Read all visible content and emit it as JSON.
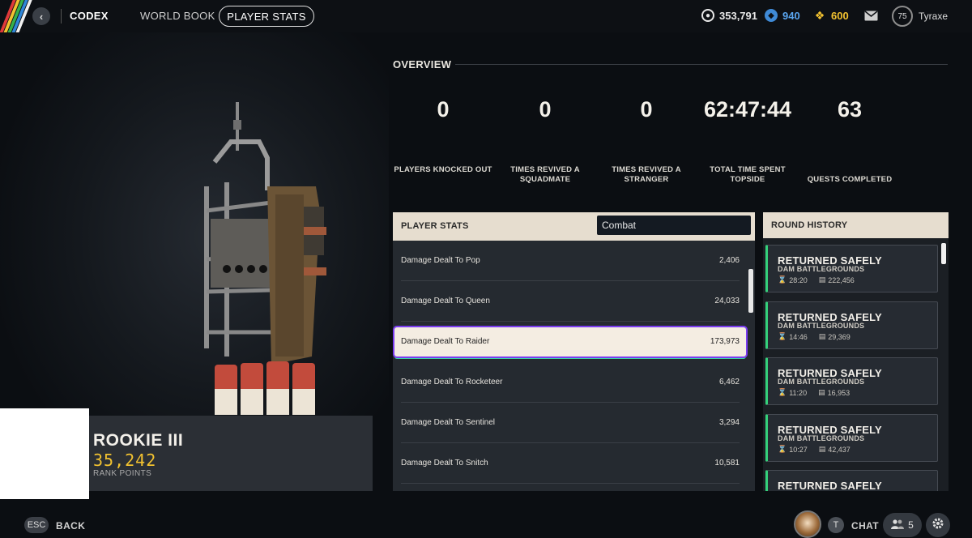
{
  "nav": {
    "codex": "CODEX",
    "world_book": "WORLD BOOK",
    "player_stats": "PLAYER STATS"
  },
  "currency": {
    "coins": "353,791",
    "blue": "940",
    "gold": "600"
  },
  "user": {
    "level": "75",
    "name": "Tyraxe"
  },
  "rank": {
    "name": "ROOKIE III",
    "points": "35,242",
    "label": "RANK POINTS"
  },
  "overview": {
    "title": "OVERVIEW",
    "stats": [
      {
        "value": "0",
        "label": "PLAYERS KNOCKED OUT"
      },
      {
        "value": "0",
        "label": "TIMES REVIVED A SQUADMATE"
      },
      {
        "value": "0",
        "label": "TIMES REVIVED A STRANGER"
      },
      {
        "value": "62:47:44",
        "label": "TOTAL TIME SPENT TOPSIDE"
      },
      {
        "value": "63",
        "label": "QUESTS COMPLETED"
      }
    ]
  },
  "player_stats": {
    "title": "PLAYER STATS",
    "category": "Combat",
    "rows": [
      {
        "name": "Damage Dealt To Pop",
        "value": "2,406"
      },
      {
        "name": "Damage Dealt To Queen",
        "value": "24,033"
      },
      {
        "name": "Damage Dealt To Raider",
        "value": "173,973"
      },
      {
        "name": "Damage Dealt To Rocketeer",
        "value": "6,462"
      },
      {
        "name": "Damage Dealt To Sentinel",
        "value": "3,294"
      },
      {
        "name": "Damage Dealt To Snitch",
        "value": "10,581"
      }
    ]
  },
  "round_history": {
    "title": "ROUND HISTORY",
    "rounds": [
      {
        "result": "RETURNED SAFELY",
        "map": "DAM BATTLEGROUNDS",
        "time": "28:20",
        "loot": "222,456"
      },
      {
        "result": "RETURNED SAFELY",
        "map": "DAM BATTLEGROUNDS",
        "time": "14:46",
        "loot": "29,369"
      },
      {
        "result": "RETURNED SAFELY",
        "map": "DAM BATTLEGROUNDS",
        "time": "11:20",
        "loot": "16,953"
      },
      {
        "result": "RETURNED SAFELY",
        "map": "DAM BATTLEGROUNDS",
        "time": "10:27",
        "loot": "42,437"
      },
      {
        "result": "RETURNED SAFELY",
        "map": "",
        "time": "",
        "loot": ""
      }
    ]
  },
  "footer": {
    "esc": "ESC",
    "back": "BACK",
    "t_key": "T",
    "chat": "CHAT",
    "friends_count": "5"
  },
  "colors": {
    "accent_yellow": "#f2c230",
    "success_green": "#34d17b",
    "header_beige": "#e6ddcf",
    "highlight_purple": "#7a3cf0"
  }
}
